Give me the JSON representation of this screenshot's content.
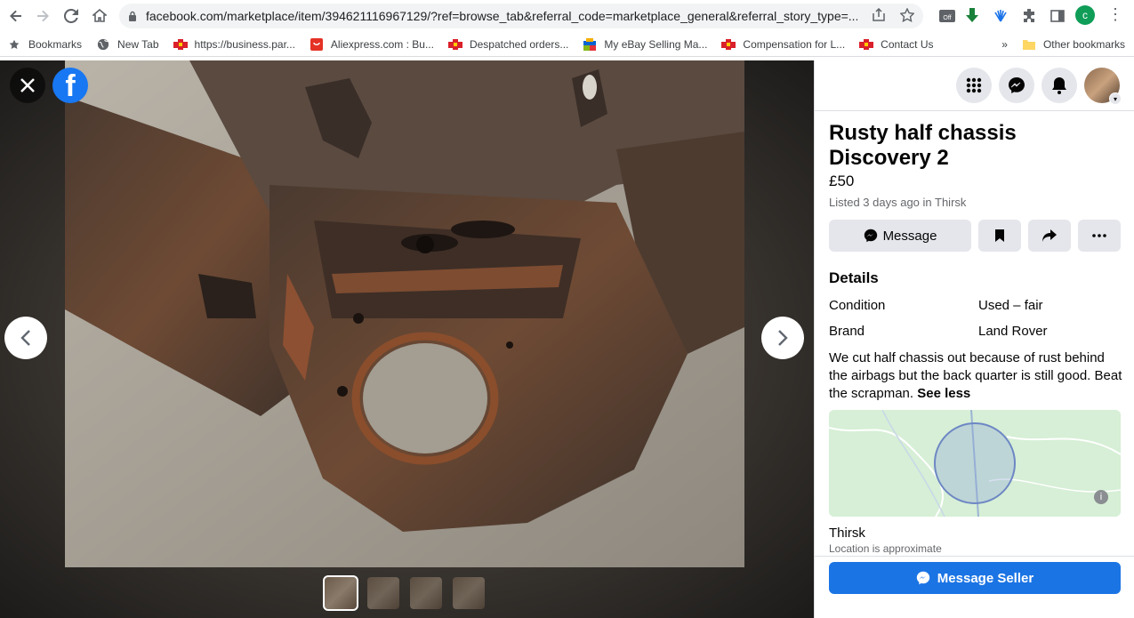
{
  "browser": {
    "url": "facebook.com/marketplace/item/394621116967129/?ref=browse_tab&referral_code=marketplace_general&referral_story_type=...",
    "profile_initial": "c",
    "bookmarks": [
      {
        "label": "Bookmarks",
        "icon": "star-icon"
      },
      {
        "label": "New Tab",
        "icon": "globe-icon"
      },
      {
        "label": "https://business.par...",
        "icon": "royal-mail-icon"
      },
      {
        "label": "Aliexpress.com : Bu...",
        "icon": "aliexpress-icon"
      },
      {
        "label": "Despatched orders...",
        "icon": "royal-mail-icon"
      },
      {
        "label": "My eBay Selling Ma...",
        "icon": "ebay-icon"
      },
      {
        "label": "Compensation for L...",
        "icon": "royal-mail-icon"
      },
      {
        "label": "Contact Us",
        "icon": "royal-mail-icon"
      }
    ],
    "more_bookmarks": "»",
    "other_bookmarks": "Other bookmarks"
  },
  "viewer": {
    "close_icon": "close-icon",
    "logo_letter": "f",
    "thumbnail_count": 4
  },
  "listing": {
    "title": "Rusty half chassis Discovery 2",
    "price": "£50",
    "listed": "Listed 3 days ago in Thirsk",
    "message_label": "Message",
    "details_heading": "Details",
    "details": [
      {
        "key": "Condition",
        "value": "Used – fair"
      },
      {
        "key": "Brand",
        "value": "Land Rover"
      }
    ],
    "description": "We cut half chassis out because of rust behind the airbags but the back quarter is still good. Beat the scrapman.",
    "see_less": "See less",
    "location": "Thirsk",
    "location_note": "Location is approximate",
    "seller_button": "Message Seller"
  },
  "colors": {
    "accent": "#1b74e4",
    "fb_blue": "#1877f2"
  }
}
